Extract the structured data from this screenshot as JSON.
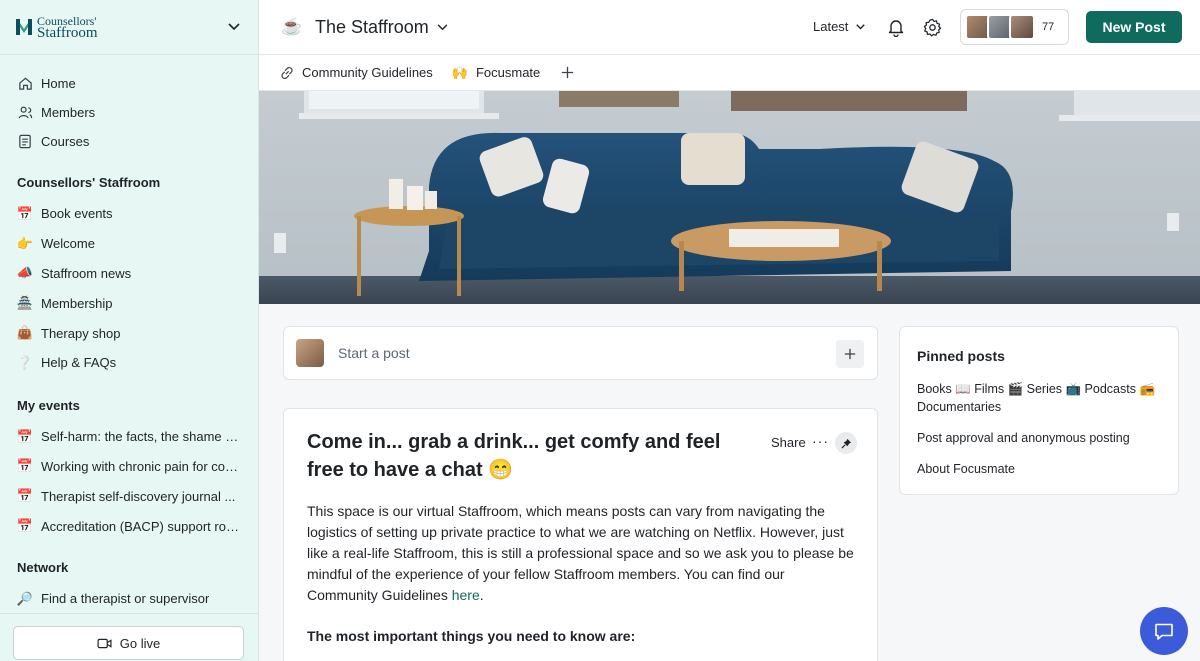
{
  "brand": {
    "line1": "Counsellors'",
    "line2": "Staffroom"
  },
  "colors": {
    "accent": "#0f6b5e",
    "sidebar_bg": "#e7f7f4",
    "chat_button": "#3b5bdb"
  },
  "sidebar": {
    "main_nav": [
      {
        "label": "Home",
        "icon": "home-icon"
      },
      {
        "label": "Members",
        "icon": "members-icon"
      },
      {
        "label": "Courses",
        "icon": "courses-icon"
      }
    ],
    "group_title": "Counsellors' Staffroom",
    "group_items": [
      {
        "emoji": "📅",
        "label": "Book events"
      },
      {
        "emoji": "👉",
        "label": "Welcome"
      },
      {
        "emoji": "📣",
        "label": "Staffroom news"
      },
      {
        "emoji": "🏯",
        "label": "Membership"
      },
      {
        "emoji": "👜",
        "label": "Therapy shop"
      },
      {
        "emoji": "❔",
        "label": "Help & FAQs"
      }
    ],
    "events_title": "My events",
    "events": [
      {
        "emoji": "📅",
        "label": "Self-harm: the facts, the shame a..."
      },
      {
        "emoji": "📅",
        "label": "Working with chronic pain for cou..."
      },
      {
        "emoji": "📅",
        "label": "Therapist self-discovery journal ..."
      },
      {
        "emoji": "📅",
        "label": "Accreditation (BACP) support room"
      }
    ],
    "network_title": "Network",
    "network_items": [
      {
        "emoji": "🔎",
        "label": "Find a therapist or supervisor"
      }
    ],
    "go_live": "Go live"
  },
  "header": {
    "space_emoji": "☕",
    "space_title": "The Staffroom",
    "sort_label": "Latest",
    "member_count": "77",
    "new_post": "New Post"
  },
  "tabs": [
    {
      "icon": "🔗",
      "label": "Community Guidelines"
    },
    {
      "icon": "🙌",
      "label": "Focusmate"
    }
  ],
  "composer": {
    "placeholder": "Start a post"
  },
  "post": {
    "title": "Come in... grab a drink... get comfy and feel free to have a chat 😁",
    "share": "Share",
    "more": "···",
    "body_text": "This space is our virtual Staffroom, which means posts can vary from navigating the logistics of setting up private practice to what we are watching on Netflix. However, just like a real-life Staffroom, this is still a professional space and so we ask you to please be mindful of the experience of your fellow Staffroom members. You can find our Community Guidelines ",
    "body_link": "here",
    "body_end": ".",
    "subheading": "The most important things you need to know are:"
  },
  "pinned": {
    "title": "Pinned posts",
    "items": [
      "Books 📖 Films 🎬 Series 📺 Podcasts 📻 Documentaries",
      "Post approval and anonymous posting",
      "About Focusmate"
    ]
  }
}
